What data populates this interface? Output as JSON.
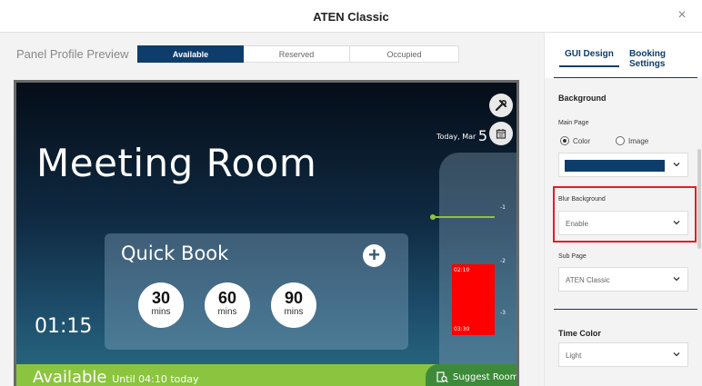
{
  "window": {
    "title": "ATEN Classic",
    "close_label": "×"
  },
  "preview": {
    "label": "Panel Profile Preview",
    "tabs": [
      {
        "label": "Available",
        "active": true
      },
      {
        "label": "Reserved",
        "active": false
      },
      {
        "label": "Occupied",
        "active": false
      }
    ]
  },
  "panel": {
    "room_name": "Meeting Room",
    "date_prefix": "Today, Mar",
    "date_day": "5",
    "time": "01:15",
    "timeline": {
      "labels": [
        "-1",
        "-2",
        "-3"
      ],
      "booking_start": "02:10",
      "booking_end": "03:30",
      "booking_color": "#ff0000"
    },
    "quick_book": {
      "title": "Quick Book",
      "options": [
        {
          "value": "30",
          "unit": "mins"
        },
        {
          "value": "60",
          "unit": "mins"
        },
        {
          "value": "90",
          "unit": "mins"
        }
      ]
    },
    "status": {
      "main": "Available",
      "sub": "Until 04:10 today",
      "color": "#8bc43f"
    },
    "suggest_room": "Suggest Room"
  },
  "settings": {
    "tabs": [
      {
        "label": "GUI Design",
        "active": true
      },
      {
        "label": "Booking Settings",
        "active": false
      }
    ],
    "background": {
      "title": "Background",
      "main_page_label": "Main Page",
      "options": [
        {
          "label": "Color",
          "checked": true
        },
        {
          "label": "Image",
          "checked": false
        }
      ],
      "selected_color": "#0e3d6b",
      "blur_label": "Blur Background",
      "blur_value": "Enable",
      "sub_page_label": "Sub Page",
      "sub_page_value": "ATEN Classic"
    },
    "time_color": {
      "title": "Time Color",
      "value": "Light"
    }
  },
  "colors": {
    "accent": "#0e3d6b",
    "highlight": "#e02020"
  }
}
